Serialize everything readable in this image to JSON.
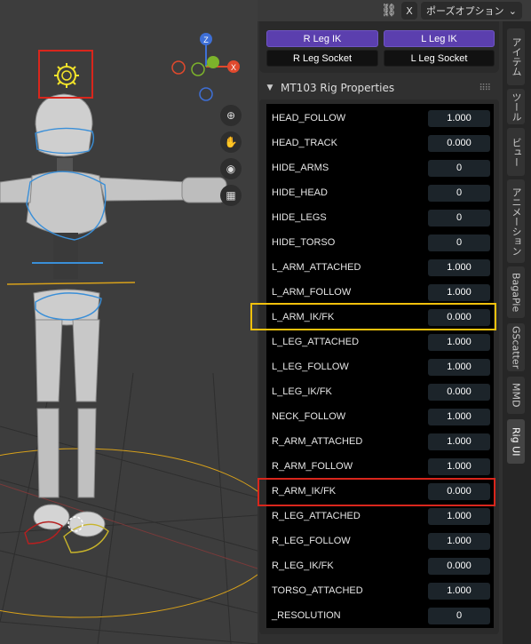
{
  "topbar": {
    "x_label": "X",
    "mode_label": "ポーズオプション"
  },
  "gizmo": {
    "z": "Z",
    "x": "X"
  },
  "leg_buttons": {
    "r_leg_ik": "R Leg IK",
    "l_leg_ik": "L Leg IK",
    "r_leg_socket": "R Leg Socket",
    "l_leg_socket": "L Leg Socket"
  },
  "rig_panel": {
    "title": "MT103 Rig Properties",
    "rows": [
      {
        "label": "HEAD_FOLLOW",
        "value": "1.000"
      },
      {
        "label": "HEAD_TRACK",
        "value": "0.000"
      },
      {
        "label": "HIDE_ARMS",
        "value": "0"
      },
      {
        "label": "HIDE_HEAD",
        "value": "0"
      },
      {
        "label": "HIDE_LEGS",
        "value": "0"
      },
      {
        "label": "HIDE_TORSO",
        "value": "0"
      },
      {
        "label": "L_ARM_ATTACHED",
        "value": "1.000"
      },
      {
        "label": "L_ARM_FOLLOW",
        "value": "1.000"
      },
      {
        "label": "L_ARM_IK/FK",
        "value": "0.000"
      },
      {
        "label": "L_LEG_ATTACHED",
        "value": "1.000"
      },
      {
        "label": "L_LEG_FOLLOW",
        "value": "1.000"
      },
      {
        "label": "L_LEG_IK/FK",
        "value": "0.000"
      },
      {
        "label": "NECK_FOLLOW",
        "value": "1.000"
      },
      {
        "label": "R_ARM_ATTACHED",
        "value": "1.000"
      },
      {
        "label": "R_ARM_FOLLOW",
        "value": "1.000"
      },
      {
        "label": "R_ARM_IK/FK",
        "value": "0.000"
      },
      {
        "label": "R_LEG_ATTACHED",
        "value": "1.000"
      },
      {
        "label": "R_LEG_FOLLOW",
        "value": "1.000"
      },
      {
        "label": "R_LEG_IK/FK",
        "value": "0.000"
      },
      {
        "label": "TORSO_ATTACHED",
        "value": "1.000"
      },
      {
        "label": "_RESOLUTION",
        "value": "0"
      }
    ]
  },
  "tabs": [
    "アイテム",
    "ツール",
    "ビュー",
    "アニメーション",
    "BagaPie",
    "GScatter",
    "MMD",
    "Rig UI"
  ],
  "colors": {
    "ik_button": "#5b3fae",
    "highlight_yellow": "#f2c10c",
    "highlight_red": "#d9261c",
    "gizmo_x": "#e0492d",
    "gizmo_y": "#7cb32b",
    "gizmo_z": "#3e6fd6"
  }
}
